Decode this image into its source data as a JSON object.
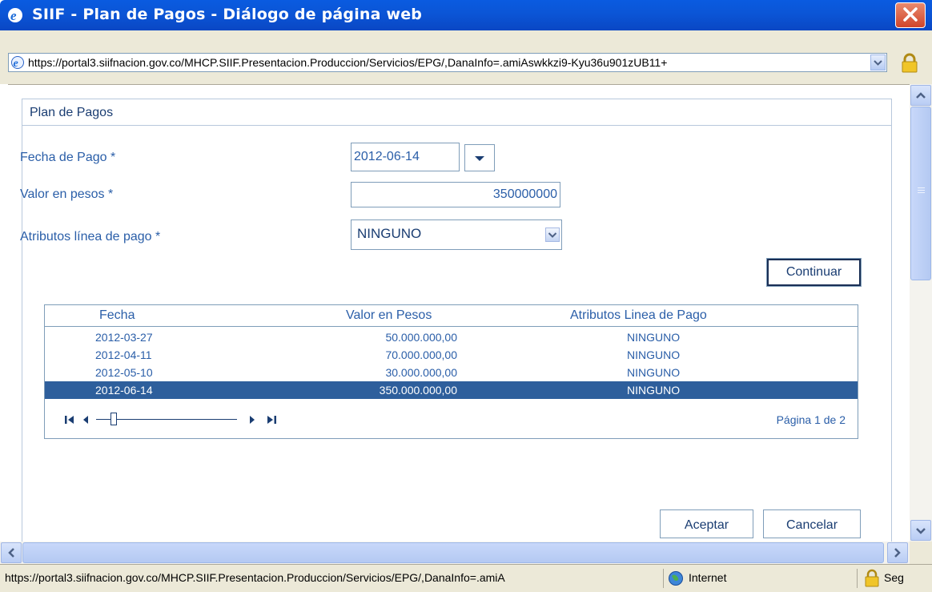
{
  "window": {
    "title": "SIIF - Plan de Pagos - Diálogo de página web",
    "url": "https://portal3.siifnacion.gov.co/MHCP.SIIF.Presentacion.Produccion/Servicios/EPG/,DanaInfo=.amiAswkkzi9-Kyu36u901zUB11+"
  },
  "panel": {
    "title": "Plan de Pagos"
  },
  "form": {
    "fecha_label": "Fecha de Pago *",
    "fecha_value": "2012-06-14",
    "valor_label": "Valor en pesos *",
    "valor_value": "350000000",
    "atributos_label": "Atributos línea de pago *",
    "atributos_value": "NINGUNO",
    "continuar_label": "Continuar"
  },
  "grid": {
    "headers": [
      "Fecha",
      "Valor en Pesos",
      "Atributos Linea de Pago"
    ],
    "rows": [
      {
        "fecha": "2012-03-27",
        "valor": "50.000.000,00",
        "atributo": "NINGUNO"
      },
      {
        "fecha": "2012-04-11",
        "valor": "70.000.000,00",
        "atributo": "NINGUNO"
      },
      {
        "fecha": "2012-05-10",
        "valor": "30.000.000,00",
        "atributo": "NINGUNO"
      },
      {
        "fecha": "2012-06-14",
        "valor": "350.000.000,00",
        "atributo": "NINGUNO"
      }
    ],
    "selected_row": 3,
    "pager_text": "Página 1 de 2"
  },
  "footer": {
    "aceptar_label": "Aceptar",
    "cancelar_label": "Cancelar"
  },
  "statusbar": {
    "url": "https://portal3.siifnacion.gov.co/MHCP.SIIF.Presentacion.Produccion/Servicios/EPG/,DanaInfo=.amiA",
    "zone": "Internet",
    "security": "Seg"
  },
  "colors": {
    "titlebar": "#0a5be0",
    "label_blue": "#2a5ea8",
    "selected_row": "#2e5f9c"
  }
}
